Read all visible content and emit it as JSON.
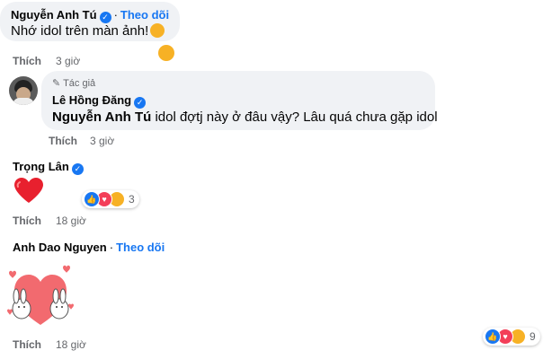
{
  "comments": [
    {
      "author": "Nguyễn Anh Tú",
      "follow_label": "Theo dõi",
      "text": "Nhớ idol trên màn ảnh!",
      "like_label": "Thích",
      "time": "3 giờ"
    },
    {
      "author_badge": "Tác giả",
      "author": "Lê Hồng Đăng",
      "mention": "Nguyễn Anh Tú",
      "text": " idol đợtj này ở đâu vậy? Lâu quá chưa gặp idol",
      "like_label": "Thích",
      "time": "3 giờ"
    },
    {
      "author": "Trọng Lân",
      "like_label": "Thích",
      "time": "18 giờ",
      "reaction_count": "3"
    },
    {
      "author": "Anh Dao Nguyen",
      "follow_label": "Theo dõi",
      "like_label": "Thích",
      "time": "18 giờ",
      "reaction_count": "9"
    }
  ],
  "colors": {
    "bubble": "#f0f2f5",
    "link": "#1877f2",
    "secondary": "#65676b",
    "like": "#1877f2",
    "love": "#f33e58",
    "care": "#f7b125"
  },
  "icons": [
    "verified-icon",
    "pencil-icon",
    "like-reaction-icon",
    "love-reaction-icon",
    "care-reaction-icon",
    "heart-emoji",
    "hug-emoji",
    "sticker-bunnies-heart"
  ]
}
